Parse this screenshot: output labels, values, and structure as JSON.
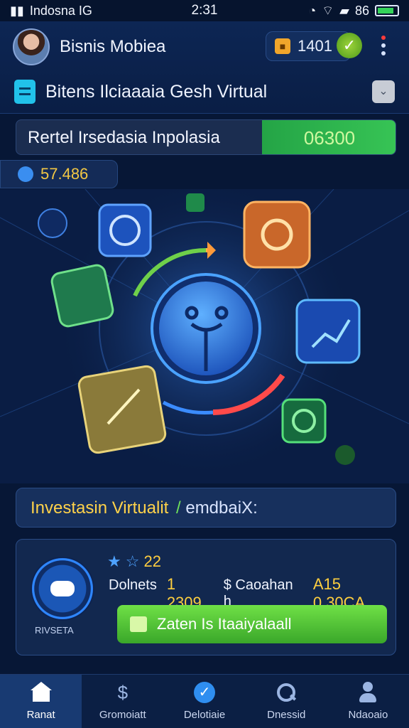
{
  "status_bar": {
    "carrier": "Indosna IG",
    "time": "2:31",
    "battery_text": "86"
  },
  "header": {
    "app_name": "Bisnis Mobiea",
    "coin_value": "1401",
    "subtitle": "Bitens Ilciaaaia Gesh Virtual"
  },
  "stats_banner": {
    "label": "Rertel Irsedasia Inpolasia",
    "value": "06300"
  },
  "balance": {
    "value": "57.486"
  },
  "invest_banner": {
    "title": "Investasin Virtualit",
    "separator": "/",
    "tag": "emdbaiX:"
  },
  "card": {
    "badge_label": "RIVSETA",
    "rating_text": "22",
    "line_label": "Dolnets",
    "line_value": "1 2309",
    "line_sep": "$ Caoahan h",
    "line_value2": "A15 0.30CA",
    "action_label": "Zaten Is Itaaiyalaall"
  },
  "bottom_nav": [
    {
      "label": "Ranat",
      "icon": "home-icon",
      "active": true
    },
    {
      "label": "Gromoiatt",
      "icon": "dollar-icon",
      "active": false
    },
    {
      "label": "Delotiaie",
      "icon": "check-icon",
      "active": false
    },
    {
      "label": "Dnessid",
      "icon": "search-icon",
      "active": false
    },
    {
      "label": "Ndaoaio",
      "icon": "user-icon",
      "active": false
    }
  ],
  "colors": {
    "background": "#071736",
    "accent_green": "#3aa72a",
    "accent_gold": "#ffcf3f",
    "accent_blue": "#2f8ef0"
  }
}
